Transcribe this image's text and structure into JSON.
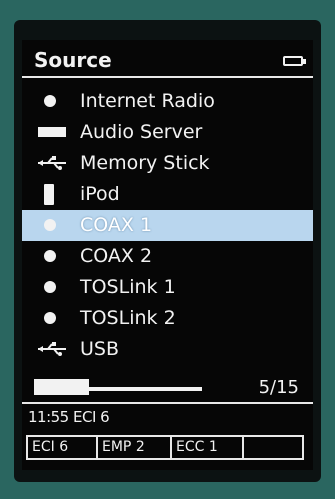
{
  "header": {
    "title": "Source"
  },
  "sources": [
    {
      "label": "Internet Radio",
      "icon": "dot-icon"
    },
    {
      "label": "Audio Server",
      "icon": "server-icon"
    },
    {
      "label": "Memory Stick",
      "icon": "usb-icon"
    },
    {
      "label": "iPod",
      "icon": "ipod-icon"
    },
    {
      "label": "COAX 1",
      "icon": "dot-icon",
      "selected": true
    },
    {
      "label": "COAX 2",
      "icon": "dot-icon"
    },
    {
      "label": "TOSLink 1",
      "icon": "dot-icon"
    },
    {
      "label": "TOSLink 2",
      "icon": "dot-icon"
    },
    {
      "label": "USB",
      "icon": "usb-icon"
    }
  ],
  "scroll": {
    "page": "5/15",
    "progress": 0.33
  },
  "status": {
    "text": "11:55 ECI 6"
  },
  "tags": [
    "ECI 6",
    "EMP 2",
    "ECC 1",
    ""
  ],
  "colors": {
    "background": "#2a6660",
    "screen": "#060606",
    "highlight": "#b9d6ee",
    "text": "#f2f2f2"
  }
}
